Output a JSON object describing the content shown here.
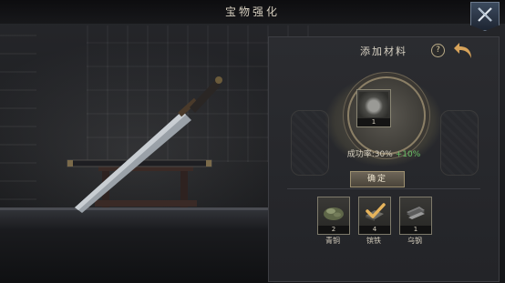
{
  "header": {
    "title": "宝物强化"
  },
  "close_icon": "close-x-icon",
  "panel": {
    "title": "添加材料",
    "help_label": "?",
    "main_item": {
      "count": "1",
      "icon": "iron-ingot-icon"
    },
    "success_rate": {
      "label": "成功率:30%",
      "bonus": "+10%"
    },
    "confirm_label": "确定"
  },
  "materials": [
    {
      "name": "青铜",
      "count": "2",
      "icon": "bronze-ore-icon",
      "selected": false
    },
    {
      "name": "镔铁",
      "count": "4",
      "icon": "fine-iron-icon",
      "selected": true
    },
    {
      "name": "乌钢",
      "count": "1",
      "icon": "black-steel-icon",
      "selected": false
    }
  ],
  "colors": {
    "accent": "#d7a35a",
    "bonus_green": "#67c067",
    "panel_bg": "#2b2c30"
  }
}
